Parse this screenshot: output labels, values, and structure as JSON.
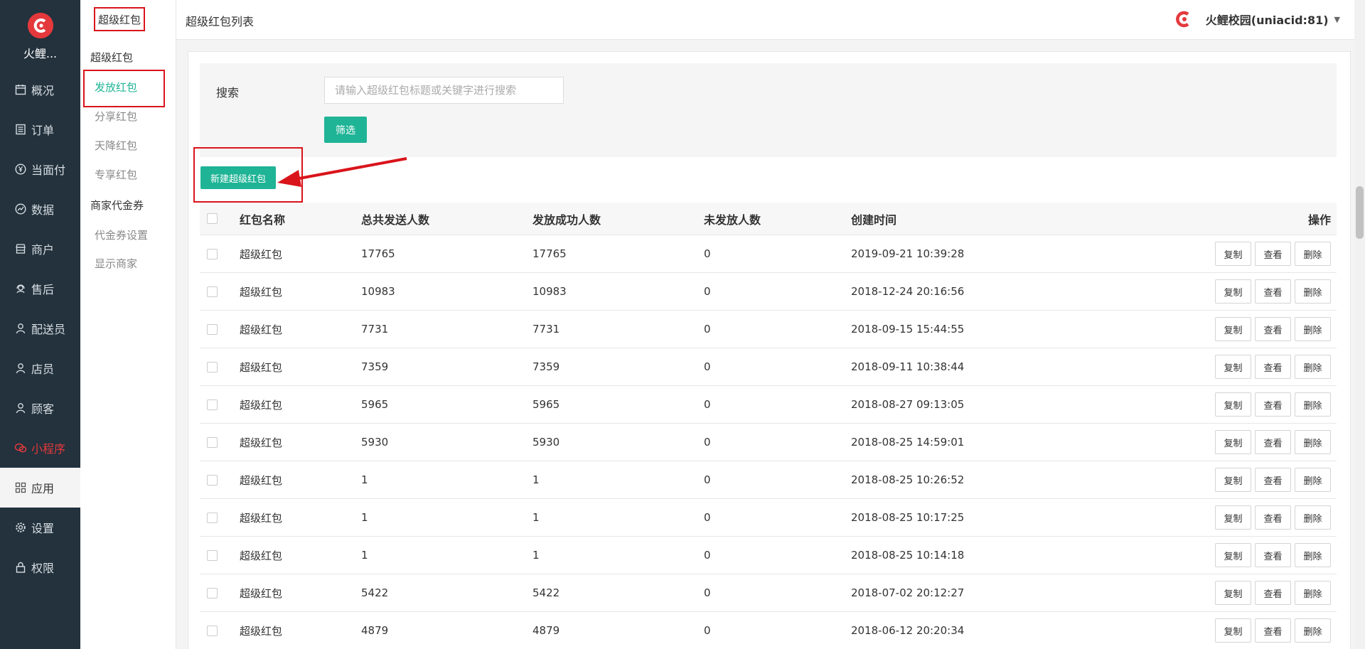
{
  "app": {
    "logo_text": "火鲤...",
    "brand_color": "#e4393c",
    "accent_color": "#1fb496"
  },
  "nav": {
    "items": [
      {
        "label": "概况",
        "icon": "calendar-icon"
      },
      {
        "label": "订单",
        "icon": "list-icon"
      },
      {
        "label": "当面付",
        "icon": "yen-icon"
      },
      {
        "label": "数据",
        "icon": "chart-icon"
      },
      {
        "label": "商户",
        "icon": "shop-icon"
      },
      {
        "label": "售后",
        "icon": "headset-icon"
      },
      {
        "label": "配送员",
        "icon": "user-icon"
      },
      {
        "label": "店员",
        "icon": "user-icon"
      },
      {
        "label": "顾客",
        "icon": "user-icon"
      },
      {
        "label": "小程序",
        "icon": "wechat-icon"
      },
      {
        "label": "应用",
        "icon": "apps-icon"
      },
      {
        "label": "设置",
        "icon": "gear-icon"
      },
      {
        "label": "权限",
        "icon": "lock-icon"
      }
    ]
  },
  "subnav": {
    "title": "超级红包",
    "group1": "超级红包",
    "group1_items": [
      "发放红包",
      "分享红包",
      "天降红包",
      "专享红包"
    ],
    "group2": "商家代金券",
    "group2_items": [
      "代金券设置",
      "显示商家"
    ]
  },
  "header": {
    "title": "超级红包列表",
    "user": "火鲤校园(uniacid:81)"
  },
  "filter": {
    "label": "搜索",
    "placeholder": "请输入超级红包标题或关键字进行搜索",
    "button": "筛选"
  },
  "new_button": "新建超级红包",
  "table": {
    "headers": {
      "name": "红包名称",
      "total": "总共发送人数",
      "success": "发放成功人数",
      "pending": "未发放人数",
      "time": "创建时间",
      "ops": "操作"
    },
    "op_labels": {
      "copy": "复制",
      "view": "查看",
      "delete": "删除"
    },
    "rows": [
      {
        "name": "超级红包",
        "total": "17765",
        "success": "17765",
        "pending": "0",
        "time": "2019-09-21 10:39:28"
      },
      {
        "name": "超级红包",
        "total": "10983",
        "success": "10983",
        "pending": "0",
        "time": "2018-12-24 20:16:56"
      },
      {
        "name": "超级红包",
        "total": "7731",
        "success": "7731",
        "pending": "0",
        "time": "2018-09-15 15:44:55"
      },
      {
        "name": "超级红包",
        "total": "7359",
        "success": "7359",
        "pending": "0",
        "time": "2018-09-11 10:38:44"
      },
      {
        "name": "超级红包",
        "total": "5965",
        "success": "5965",
        "pending": "0",
        "time": "2018-08-27 09:13:05"
      },
      {
        "name": "超级红包",
        "total": "5930",
        "success": "5930",
        "pending": "0",
        "time": "2018-08-25 14:59:01"
      },
      {
        "name": "超级红包",
        "total": "1",
        "success": "1",
        "pending": "0",
        "time": "2018-08-25 10:26:52"
      },
      {
        "name": "超级红包",
        "total": "1",
        "success": "1",
        "pending": "0",
        "time": "2018-08-25 10:17:25"
      },
      {
        "name": "超级红包",
        "total": "1",
        "success": "1",
        "pending": "0",
        "time": "2018-08-25 10:14:18"
      },
      {
        "name": "超级红包",
        "total": "5422",
        "success": "5422",
        "pending": "0",
        "time": "2018-07-02 20:12:27"
      },
      {
        "name": "超级红包",
        "total": "4879",
        "success": "4879",
        "pending": "0",
        "time": "2018-06-12 20:20:34"
      }
    ]
  }
}
